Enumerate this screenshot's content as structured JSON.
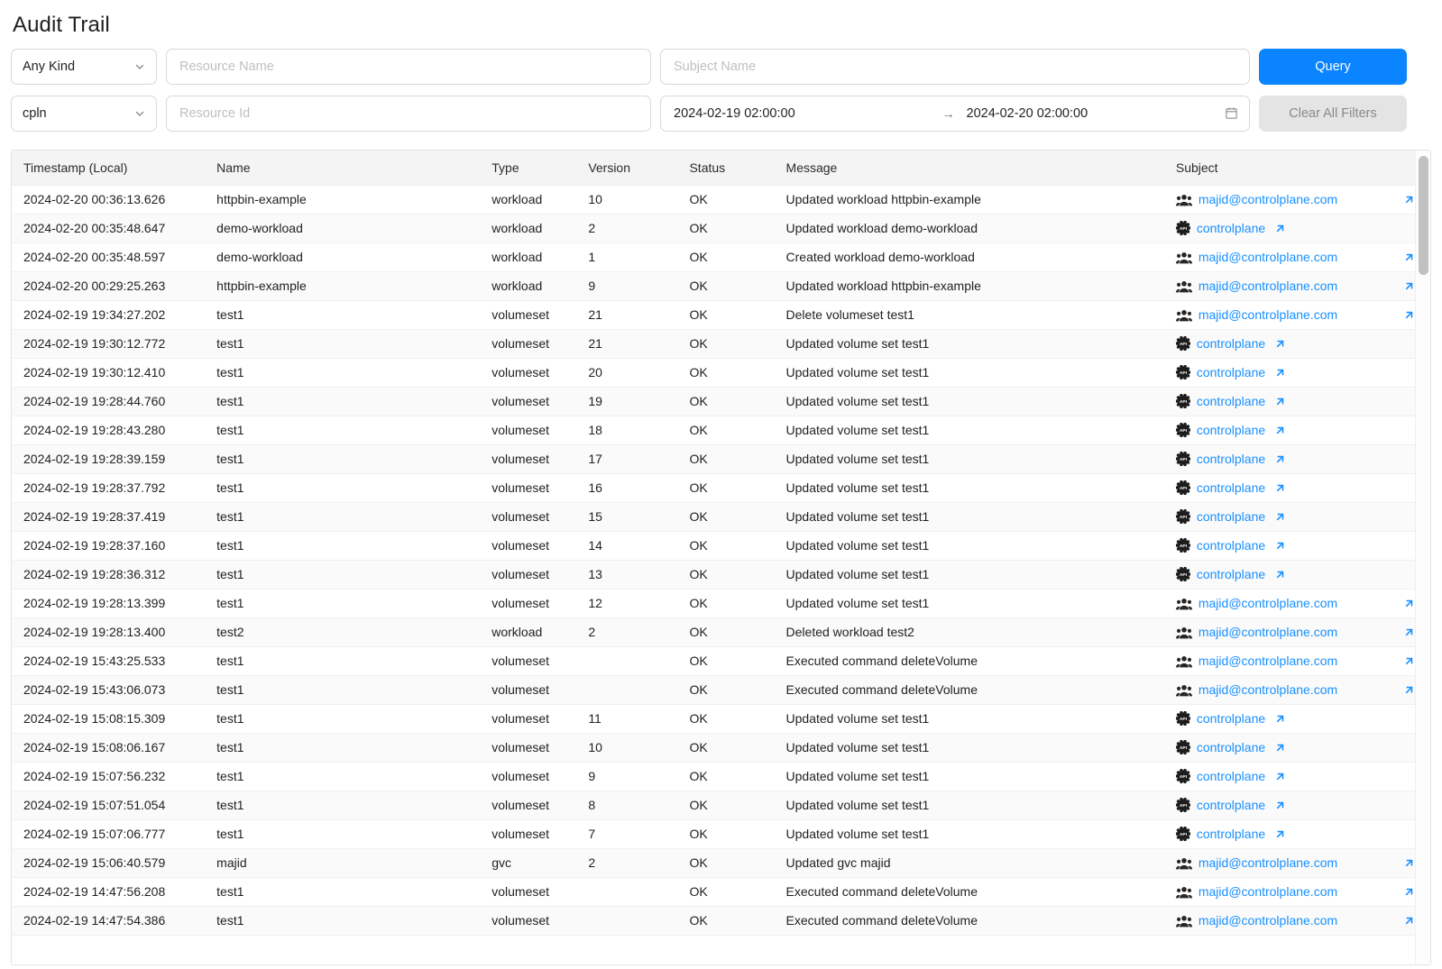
{
  "page_title": "Audit Trail",
  "filters": {
    "kind_select": {
      "value": "Any Kind",
      "icon": "chevron-down-icon"
    },
    "org_select": {
      "value": "cpln",
      "icon": "chevron-down-icon"
    },
    "resource_name": {
      "value": "",
      "placeholder": "Resource Name"
    },
    "resource_id": {
      "value": "",
      "placeholder": "Resource Id"
    },
    "subject_name": {
      "value": "",
      "placeholder": "Subject Name"
    },
    "date_range": {
      "start": "2024-02-19 02:00:00",
      "end": "2024-02-20 02:00:00",
      "separator": "→",
      "icon": "calendar-icon"
    },
    "query_button": "Query",
    "clear_button": "Clear All Filters",
    "accent_color": "#0a84ff",
    "link_color": "#1890ff"
  },
  "table": {
    "columns": [
      "Timestamp (Local)",
      "Name",
      "Type",
      "Version",
      "Status",
      "Message",
      "Subject"
    ],
    "rows": [
      {
        "timestamp": "2024-02-20 00:36:13.626",
        "name": "httpbin-example",
        "type": "workload",
        "version": "10",
        "status": "OK",
        "message": "Updated workload httpbin-example",
        "subject": "majid@controlplane.com",
        "subject_icon": "users-icon"
      },
      {
        "timestamp": "2024-02-20 00:35:48.647",
        "name": "demo-workload",
        "type": "workload",
        "version": "2",
        "status": "OK",
        "message": "Updated workload demo-workload",
        "subject": "controlplane",
        "subject_icon": "api-icon"
      },
      {
        "timestamp": "2024-02-20 00:35:48.597",
        "name": "demo-workload",
        "type": "workload",
        "version": "1",
        "status": "OK",
        "message": "Created workload demo-workload",
        "subject": "majid@controlplane.com",
        "subject_icon": "users-icon"
      },
      {
        "timestamp": "2024-02-20 00:29:25.263",
        "name": "httpbin-example",
        "type": "workload",
        "version": "9",
        "status": "OK",
        "message": "Updated workload httpbin-example",
        "subject": "majid@controlplane.com",
        "subject_icon": "users-icon"
      },
      {
        "timestamp": "2024-02-19 19:34:27.202",
        "name": "test1",
        "type": "volumeset",
        "version": "21",
        "status": "OK",
        "message": "Delete volumeset test1",
        "subject": "majid@controlplane.com",
        "subject_icon": "users-icon"
      },
      {
        "timestamp": "2024-02-19 19:30:12.772",
        "name": "test1",
        "type": "volumeset",
        "version": "21",
        "status": "OK",
        "message": "Updated volume set test1",
        "subject": "controlplane",
        "subject_icon": "api-icon"
      },
      {
        "timestamp": "2024-02-19 19:30:12.410",
        "name": "test1",
        "type": "volumeset",
        "version": "20",
        "status": "OK",
        "message": "Updated volume set test1",
        "subject": "controlplane",
        "subject_icon": "api-icon"
      },
      {
        "timestamp": "2024-02-19 19:28:44.760",
        "name": "test1",
        "type": "volumeset",
        "version": "19",
        "status": "OK",
        "message": "Updated volume set test1",
        "subject": "controlplane",
        "subject_icon": "api-icon"
      },
      {
        "timestamp": "2024-02-19 19:28:43.280",
        "name": "test1",
        "type": "volumeset",
        "version": "18",
        "status": "OK",
        "message": "Updated volume set test1",
        "subject": "controlplane",
        "subject_icon": "api-icon"
      },
      {
        "timestamp": "2024-02-19 19:28:39.159",
        "name": "test1",
        "type": "volumeset",
        "version": "17",
        "status": "OK",
        "message": "Updated volume set test1",
        "subject": "controlplane",
        "subject_icon": "api-icon"
      },
      {
        "timestamp": "2024-02-19 19:28:37.792",
        "name": "test1",
        "type": "volumeset",
        "version": "16",
        "status": "OK",
        "message": "Updated volume set test1",
        "subject": "controlplane",
        "subject_icon": "api-icon"
      },
      {
        "timestamp": "2024-02-19 19:28:37.419",
        "name": "test1",
        "type": "volumeset",
        "version": "15",
        "status": "OK",
        "message": "Updated volume set test1",
        "subject": "controlplane",
        "subject_icon": "api-icon"
      },
      {
        "timestamp": "2024-02-19 19:28:37.160",
        "name": "test1",
        "type": "volumeset",
        "version": "14",
        "status": "OK",
        "message": "Updated volume set test1",
        "subject": "controlplane",
        "subject_icon": "api-icon"
      },
      {
        "timestamp": "2024-02-19 19:28:36.312",
        "name": "test1",
        "type": "volumeset",
        "version": "13",
        "status": "OK",
        "message": "Updated volume set test1",
        "subject": "controlplane",
        "subject_icon": "api-icon"
      },
      {
        "timestamp": "2024-02-19 19:28:13.399",
        "name": "test1",
        "type": "volumeset",
        "version": "12",
        "status": "OK",
        "message": "Updated volume set test1",
        "subject": "majid@controlplane.com",
        "subject_icon": "users-icon"
      },
      {
        "timestamp": "2024-02-19 19:28:13.400",
        "name": "test2",
        "type": "workload",
        "version": "2",
        "status": "OK",
        "message": "Deleted workload test2",
        "subject": "majid@controlplane.com",
        "subject_icon": "users-icon"
      },
      {
        "timestamp": "2024-02-19 15:43:25.533",
        "name": "test1",
        "type": "volumeset",
        "version": "",
        "status": "OK",
        "message": "Executed command deleteVolume",
        "subject": "majid@controlplane.com",
        "subject_icon": "users-icon"
      },
      {
        "timestamp": "2024-02-19 15:43:06.073",
        "name": "test1",
        "type": "volumeset",
        "version": "",
        "status": "OK",
        "message": "Executed command deleteVolume",
        "subject": "majid@controlplane.com",
        "subject_icon": "users-icon"
      },
      {
        "timestamp": "2024-02-19 15:08:15.309",
        "name": "test1",
        "type": "volumeset",
        "version": "11",
        "status": "OK",
        "message": "Updated volume set test1",
        "subject": "controlplane",
        "subject_icon": "api-icon"
      },
      {
        "timestamp": "2024-02-19 15:08:06.167",
        "name": "test1",
        "type": "volumeset",
        "version": "10",
        "status": "OK",
        "message": "Updated volume set test1",
        "subject": "controlplane",
        "subject_icon": "api-icon"
      },
      {
        "timestamp": "2024-02-19 15:07:56.232",
        "name": "test1",
        "type": "volumeset",
        "version": "9",
        "status": "OK",
        "message": "Updated volume set test1",
        "subject": "controlplane",
        "subject_icon": "api-icon"
      },
      {
        "timestamp": "2024-02-19 15:07:51.054",
        "name": "test1",
        "type": "volumeset",
        "version": "8",
        "status": "OK",
        "message": "Updated volume set test1",
        "subject": "controlplane",
        "subject_icon": "api-icon"
      },
      {
        "timestamp": "2024-02-19 15:07:06.777",
        "name": "test1",
        "type": "volumeset",
        "version": "7",
        "status": "OK",
        "message": "Updated volume set test1",
        "subject": "controlplane",
        "subject_icon": "api-icon"
      },
      {
        "timestamp": "2024-02-19 15:06:40.579",
        "name": "majid",
        "type": "gvc",
        "version": "2",
        "status": "OK",
        "message": "Updated gvc majid",
        "subject": "majid@controlplane.com",
        "subject_icon": "users-icon"
      },
      {
        "timestamp": "2024-02-19 14:47:56.208",
        "name": "test1",
        "type": "volumeset",
        "version": "",
        "status": "OK",
        "message": "Executed command deleteVolume",
        "subject": "majid@controlplane.com",
        "subject_icon": "users-icon"
      },
      {
        "timestamp": "2024-02-19 14:47:54.386",
        "name": "test1",
        "type": "volumeset",
        "version": "",
        "status": "OK",
        "message": "Executed command deleteVolume",
        "subject": "majid@controlplane.com",
        "subject_icon": "users-icon"
      }
    ]
  },
  "scrollbar": {
    "orientation": "vertical",
    "thumb_position": "top"
  }
}
